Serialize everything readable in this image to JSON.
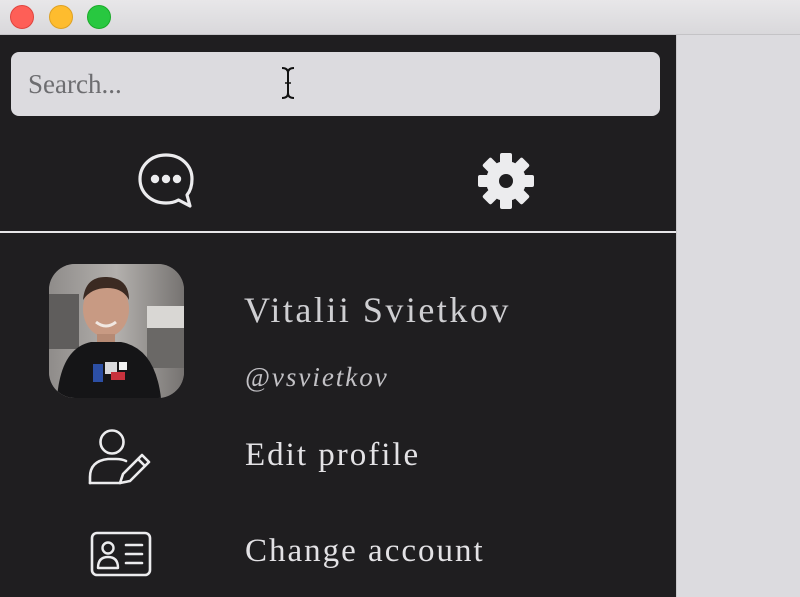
{
  "search": {
    "placeholder": "Search...",
    "value": ""
  },
  "toolbar": {
    "chat_icon": "chat-bubble-ellipsis-icon",
    "settings_icon": "gear-icon"
  },
  "profile": {
    "name": "Vitalii Svietkov",
    "handle": "@vsvietkov"
  },
  "menu": {
    "items": [
      {
        "label": "Edit profile",
        "icon": "edit-user-icon"
      },
      {
        "label": "Change account",
        "icon": "id-card-icon"
      }
    ]
  },
  "colors": {
    "sidebar_bg": "#1f1e20",
    "search_bg": "#dcdbdf",
    "text_primary": "#e3e2e5",
    "text_secondary": "#cfcfd2"
  }
}
